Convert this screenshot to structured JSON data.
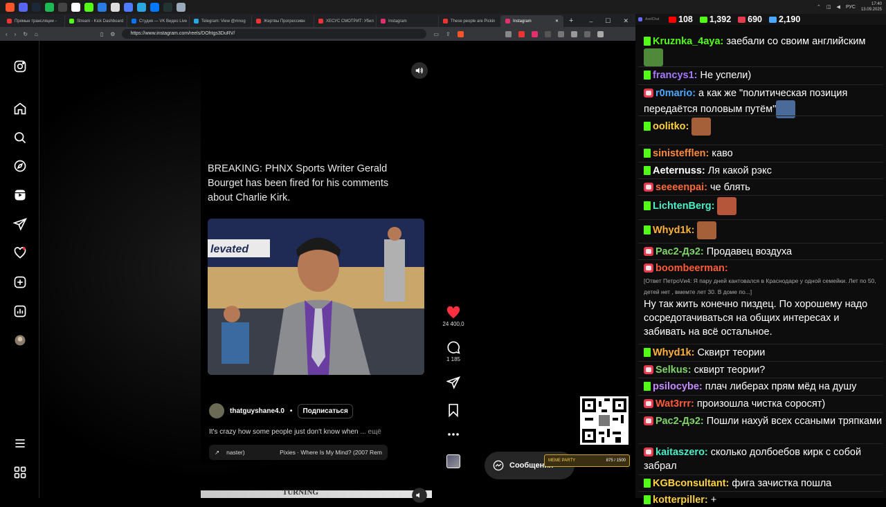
{
  "taskbar": {
    "icons": [
      {
        "name": "brave-icon",
        "color": "#fb542b"
      },
      {
        "name": "discord-icon",
        "color": "#5865f2"
      },
      {
        "name": "steam-icon",
        "color": "#1b2838"
      },
      {
        "name": "spotify-icon",
        "color": "#1db954"
      },
      {
        "name": "obs-icon",
        "color": "#444"
      },
      {
        "name": "app-icon",
        "color": "#fff"
      },
      {
        "name": "kick-icon",
        "color": "#53fc18"
      },
      {
        "name": "app-blue-icon",
        "color": "#2b7be4"
      },
      {
        "name": "file-icon",
        "color": "#ddd"
      },
      {
        "name": "video-icon",
        "color": "#4f7cff"
      },
      {
        "name": "telegram-icon",
        "color": "#2aa6e0"
      },
      {
        "name": "vk-icon",
        "color": "#0077ff"
      },
      {
        "name": "steam2-icon",
        "color": "#233"
      },
      {
        "name": "shield-icon",
        "color": "#9ab"
      }
    ],
    "lang": "РУС",
    "time": "17:40",
    "date": "13.09.2025"
  },
  "browser": {
    "tabs": [
      {
        "label": "Прямые трансляции - ",
        "color": "#e33"
      },
      {
        "label": "Stream - Kick Dashboard",
        "color": "#53fc18"
      },
      {
        "label": "Студия — VK Видео Live",
        "color": "#0077ff"
      },
      {
        "label": "Telegram: View @mnog",
        "color": "#2aa6e0"
      },
      {
        "label": "Жертвы Прогрессивн",
        "color": "#e33"
      },
      {
        "label": "ХЕСУС СМОТРИТ: Убил",
        "color": "#e33"
      },
      {
        "label": "Instagram",
        "color": "#e1306c"
      },
      {
        "label": "These people are Pickin",
        "color": "#e33"
      },
      {
        "label": "Instagram",
        "color": "#e1306c"
      }
    ],
    "url": "https://www.instagram.com/reels/DOhtgs3DuRV/"
  },
  "reel": {
    "headline": "BREAKING: PHNX Sports Writer Gerald Bourget has been fired for his comments about Charlie Kirk.",
    "author": "thatguyshane4.0",
    "dot": "•",
    "follow": "Подписаться",
    "caption": "It's crazy how some people just don't know when",
    "more": "... ещё",
    "audio_left": "naster)",
    "audio_right": "Pixies · Where Is My Mind? (2007 Rem",
    "photo_text": "levated",
    "likes": "24 400,0",
    "comments": "1 185",
    "next_text": "TURNING"
  },
  "messages_label": "Сообщения",
  "meme_party": {
    "label": "MEME PARTY",
    "progress": "875 / 1500"
  },
  "chat": {
    "header_label": "AxelChat",
    "stats": [
      {
        "name": "youtube",
        "value": "108",
        "color": "#ff0000"
      },
      {
        "name": "kick",
        "value": "1,392",
        "color": "#53fc18"
      },
      {
        "name": "vk",
        "value": "690",
        "color": "#e63a4f"
      },
      {
        "name": "viewers",
        "value": "2,190",
        "color": "#4aa8ff"
      }
    ],
    "messages": [
      {
        "badge": "k",
        "nick": "Kruznka_4aya:",
        "color": "#53fc18",
        "text": " заебали со своим английским",
        "emote": "#4f8a3a"
      },
      {
        "badge": "k",
        "nick": "francys1:",
        "color": "#a678ff",
        "text": " Не успели)"
      },
      {
        "badge": "v",
        "nick": "r0mario:",
        "color": "#4aa8ff",
        "text": " а как же \"политическая позиция передаётся половым путём\"",
        "emote": "#4a6a9a"
      },
      {
        "badge": "k",
        "nick": "oolitko:",
        "color": "#ffd23a",
        "text": " ",
        "emote": "#a5603a"
      },
      {
        "badge": "k",
        "nick": "sinistefflen:",
        "color": "#ff8a3a",
        "text": " каво"
      },
      {
        "badge": "k",
        "nick": "Aeternuss:",
        "color": "#ffffff",
        "text": " Ля какой рэкс"
      },
      {
        "badge": "v",
        "nick": "seeeenpai:",
        "color": "#ff6a3a",
        "text": " че блять"
      },
      {
        "badge": "k",
        "nick": "LichtenBerg:",
        "color": "#4af0c8",
        "text": " ",
        "emote": "#b5553a"
      },
      {
        "badge": "k",
        "nick": "Whyd1k:",
        "color": "#ffb23a",
        "text": " ",
        "emote": "#a5603a"
      },
      {
        "badge": "v",
        "nick": "Рас2-Дэ2:",
        "color": "#7ed36a",
        "text": " Продавец воздуха"
      },
      {
        "badge": "v",
        "nick": "boombeerman:",
        "color": "#ff5a3a",
        "text": "",
        "reply": "[Ответ ПетроVи4: Я пару дней кантовался в Краснодаре у одной семейки. Лет по 50, детей нет , вмемте лет 30. В доме по...]",
        "text2": "Ну так жить конечно пиздец. По хорошему надо сосредотачиваться на общих интересах и забивать на всё остальное."
      },
      {
        "badge": "k",
        "nick": "Whyd1k:",
        "color": "#ffb23a",
        "text": " Сквирт теории"
      },
      {
        "badge": "v",
        "nick": "Selkus:",
        "color": "#7ed36a",
        "text": " сквирт теории?"
      },
      {
        "badge": "k",
        "nick": "psilocybe:",
        "color": "#c58aff",
        "text": " плач либерах прям мёд на душу"
      },
      {
        "badge": "v",
        "nick": "Wat3rrr:",
        "color": "#ff5a3a",
        "text": " произошла чистка соросят)"
      },
      {
        "badge": "v",
        "nick": "Рас2-Дэ2:",
        "color": "#7ed36a",
        "text": " Пошли нахуй всех ссаными тряпками"
      },
      {
        "badge": "v",
        "nick": "kaitaszero:",
        "color": "#4af0c8",
        "text": " сколько долбоебов кирк с собой забрал"
      },
      {
        "badge": "k",
        "nick": "KGBconsultant:",
        "color": "#ffd23a",
        "text": " фига зачистка пошла"
      },
      {
        "badge": "k",
        "nick": "kotterpiller:",
        "color": "#ffd23a",
        "text": " +"
      }
    ]
  }
}
